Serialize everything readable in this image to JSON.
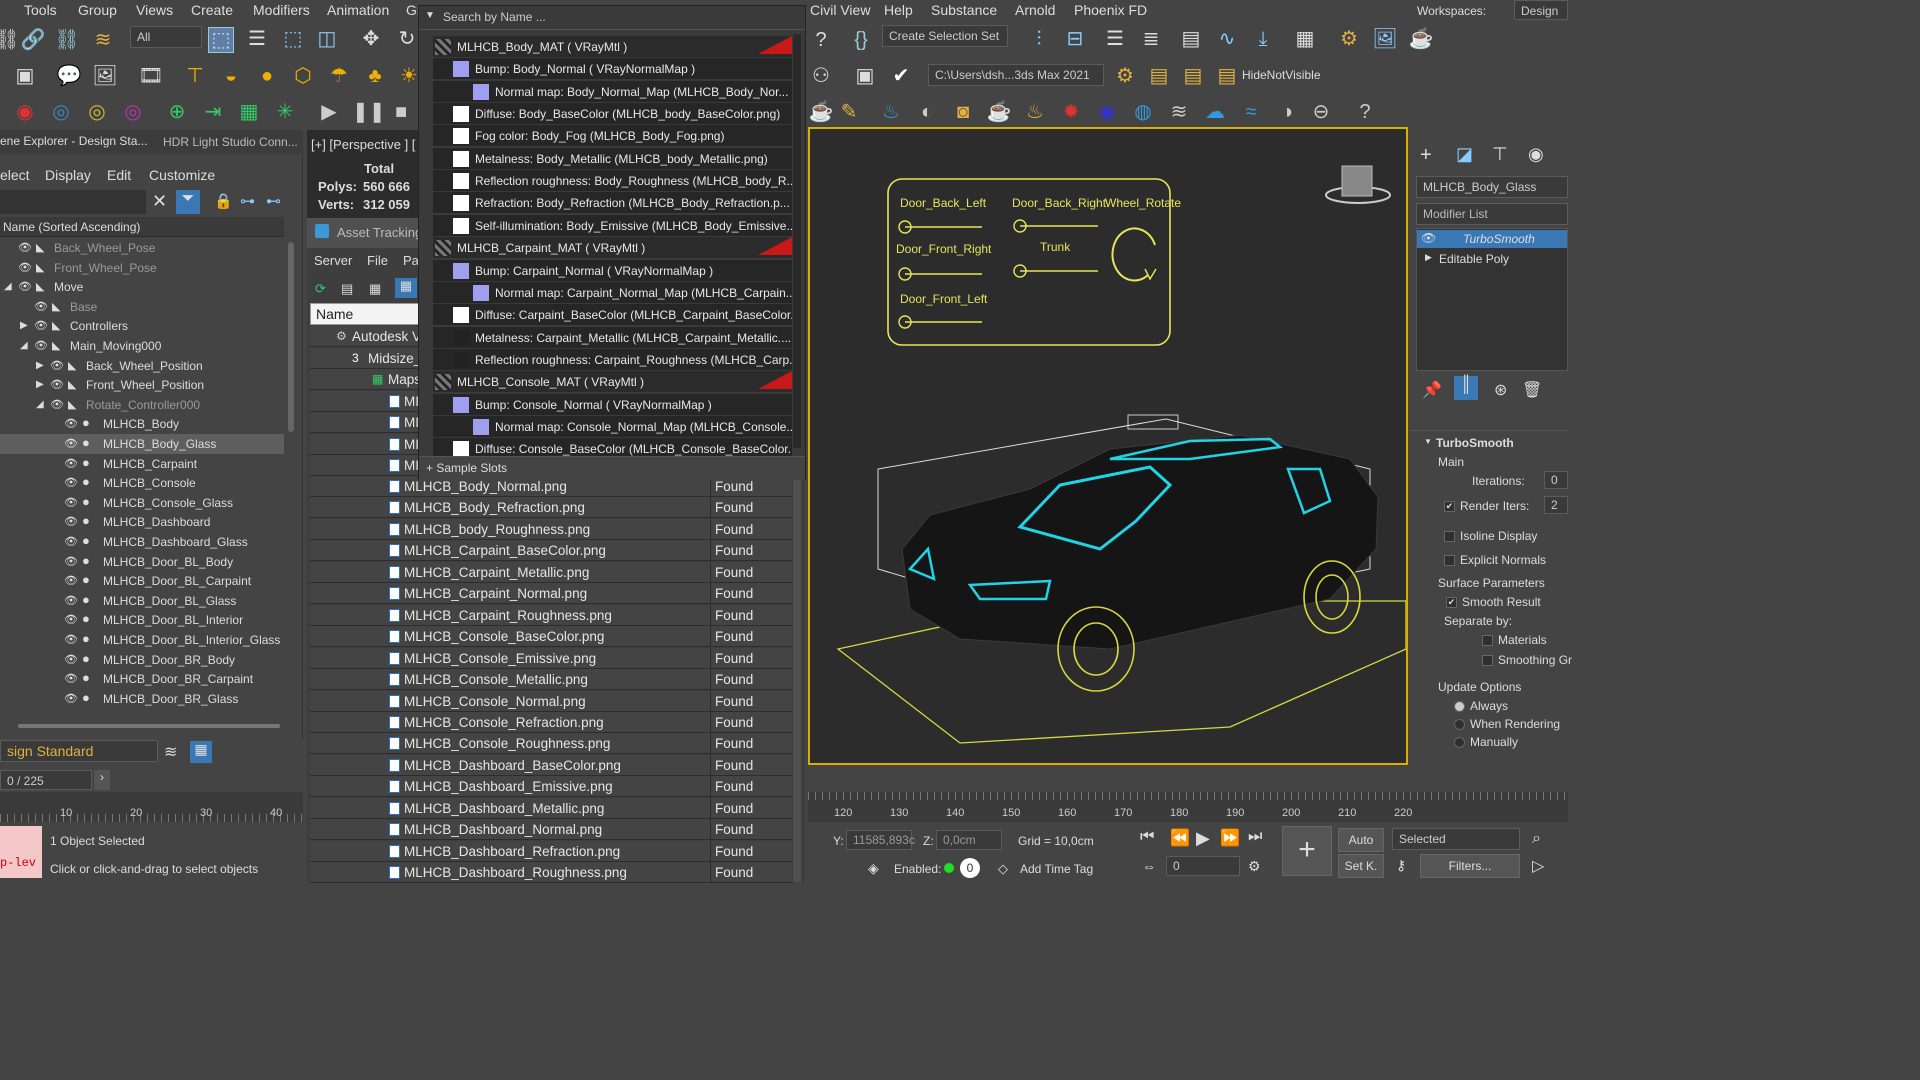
{
  "menu": {
    "tools": "Tools",
    "group": "Group",
    "views": "Views",
    "create": "Create",
    "modifiers": "Modifiers",
    "animation": "Animation",
    "gr": "Gr",
    "civil_view": "Civil View",
    "help": "Help",
    "substance": "Substance",
    "arnold": "Arnold",
    "phoenix": "Phoenix FD",
    "workspaces_label": "Workspaces:",
    "workspaces_value": "Design Standa"
  },
  "toolbar": {
    "filter_value": "All",
    "selection_set": "Create Selection Set",
    "path_value": "C:\\Users\\dsh...3ds Max 2021",
    "hide_not_visible": "HideNotVisible"
  },
  "scene_explorer": {
    "tab1": "ene Explorer - Design Sta...",
    "tab2": "HDR Light Studio Conn...",
    "menu": [
      "elect",
      "Display",
      "Edit",
      "Customize"
    ],
    "header": "Name (Sorted Ascending)",
    "rows": [
      "Back_Wheel_Pose",
      "Front_Wheel_Pose",
      "Move",
      "Base",
      "Controllers",
      "Main_Moving000",
      "Back_Wheel_Position",
      "Front_Wheel_Position",
      "Rotate_Controller000",
      "MLHCB_Body",
      "MLHCB_Body_Glass",
      "MLHCB_Carpaint",
      "MLHCB_Console",
      "MLHCB_Console_Glass",
      "MLHCB_Dashboard",
      "MLHCB_Dashboard_Glass",
      "MLHCB_Door_BL_Body",
      "MLHCB_Door_BL_Carpaint",
      "MLHCB_Door_BL_Glass",
      "MLHCB_Door_BL_Interior",
      "MLHCB_Door_BL_Interior_Glass",
      "MLHCB_Door_BR_Body",
      "MLHCB_Door_BR_Carpaint",
      "MLHCB_Door_BR_Glass"
    ],
    "workspace": "sign Standard",
    "frame_counter": "0 / 225"
  },
  "viewport_label": {
    "label": "[+] [Perspective ] [",
    "total": "Total",
    "polys_label": "Polys:",
    "polys_value": "560 666",
    "verts_label": "Verts:",
    "verts_value": "312 059"
  },
  "asset_tracking": {
    "title": "Asset Tracking",
    "menu": [
      "Server",
      "File",
      "Pa"
    ],
    "col_name": "Name",
    "tree": [
      "Autodesk Va",
      "Midsize_",
      "Maps",
      "MI",
      "MI",
      "MI",
      "MI"
    ],
    "files": [
      {
        "name": "MLHCB_Body_Normal.png",
        "status": "Found"
      },
      {
        "name": "MLHCB_Body_Refraction.png",
        "status": "Found"
      },
      {
        "name": "MLHCB_body_Roughness.png",
        "status": "Found"
      },
      {
        "name": "MLHCB_Carpaint_BaseColor.png",
        "status": "Found"
      },
      {
        "name": "MLHCB_Carpaint_Metallic.png",
        "status": "Found"
      },
      {
        "name": "MLHCB_Carpaint_Normal.png",
        "status": "Found"
      },
      {
        "name": "MLHCB_Carpaint_Roughness.png",
        "status": "Found"
      },
      {
        "name": "MLHCB_Console_BaseColor.png",
        "status": "Found"
      },
      {
        "name": "MLHCB_Console_Emissive.png",
        "status": "Found"
      },
      {
        "name": "MLHCB_Console_Metallic.png",
        "status": "Found"
      },
      {
        "name": "MLHCB_Console_Normal.png",
        "status": "Found"
      },
      {
        "name": "MLHCB_Console_Refraction.png",
        "status": "Found"
      },
      {
        "name": "MLHCB_Console_Roughness.png",
        "status": "Found"
      },
      {
        "name": "MLHCB_Dashboard_BaseColor.png",
        "status": "Found"
      },
      {
        "name": "MLHCB_Dashboard_Emissive.png",
        "status": "Found"
      },
      {
        "name": "MLHCB_Dashboard_Metallic.png",
        "status": "Found"
      },
      {
        "name": "MLHCB_Dashboard_Normal.png",
        "status": "Found"
      },
      {
        "name": "MLHCB_Dashboard_Refraction.png",
        "status": "Found"
      },
      {
        "name": "MLHCB_Dashboard_Roughness.png",
        "status": "Found"
      }
    ]
  },
  "material_browser": {
    "search_placeholder": "Search by Name ...",
    "rows": [
      "MLHCB_Body_MAT  ( VRayMtl )",
      "Bump: Body_Normal  ( VRayNormalMap )",
      "Normal map: Body_Normal_Map  (MLHCB_Body_Nor...",
      "Diffuse: Body_BaseColor (MLHCB_body_BaseColor.png)",
      "Fog color: Body_Fog (MLHCB_Body_Fog.png)",
      "Metalness: Body_Metallic (MLHCB_body_Metallic.png)",
      "Reflection roughness:  Body_Roughness  (MLHCB_body_R...",
      "Refraction:  Body_Refraction  (MLHCB_Body_Refraction.p...",
      "Self-illumination:  Body_Emissive  (MLHCB_Body_Emissive...",
      "MLHCB_Carpaint_MAT  ( VRayMtl )",
      "Bump: Carpaint_Normal  ( VRayNormalMap )",
      "Normal map: Carpaint_Normal_Map  (MLHCB_Carpain...",
      "Diffuse:  Carpaint_BaseColor  (MLHCB_Carpaint_BaseColor...",
      "Metalness:  Carpaint_Metallic  (MLHCB_Carpaint_Metallic....",
      "Reflection roughness:  Carpaint_Roughness  (MLHCB_Carp...",
      "MLHCB_Console_MAT  ( VRayMtl )",
      "Bump: Console_Normal  ( VRayNormalMap )",
      "Normal map: Console_Normal_Map  (MLHCB_Console....",
      "Diffuse:  Console_BaseColor  (MLHCB_Console_BaseColor..."
    ],
    "sample_slots": "+ Sample Slots"
  },
  "viewport_ui": {
    "labels": [
      "Door_Back_Left",
      "Door_Back_Right",
      "Wheel_Rotate",
      "Door_Front_Right",
      "Trunk",
      "Door_Front_Left"
    ]
  },
  "command_panel": {
    "object_name": "MLHCB_Body_Glass",
    "modifier_list": "Modifier List",
    "stack": [
      "TurboSmooth",
      "Editable Poly"
    ],
    "section": "TurboSmooth",
    "main": "Main",
    "iterations_label": "Iterations:",
    "iterations_value": "0",
    "render_iters_label": "Render Iters:",
    "render_iters_value": "2",
    "isoline": "Isoline Display",
    "explicit_normals": "Explicit Normals",
    "surface_params": "Surface Parameters",
    "smooth_result": "Smooth Result",
    "separate_by": "Separate by:",
    "materials": "Materials",
    "smoothing_groups": "Smoothing Gr",
    "update_options": "Update Options",
    "always": "Always",
    "when_rendering": "When Rendering",
    "manually": "Manually"
  },
  "timeline": {
    "left_ticks": [
      "10",
      "20",
      "30",
      "40"
    ],
    "right_ticks": [
      "120",
      "130",
      "140",
      "150",
      "160",
      "170",
      "180",
      "190",
      "200",
      "210",
      "220"
    ]
  },
  "status": {
    "maxscript": "p-lev",
    "objects_selected": "1 Object Selected",
    "prompt": "Click or click-and-drag to select objects",
    "y_label": "Y:",
    "y_value": "11585,893c",
    "z_label": "Z:",
    "z_value": "0,0cm",
    "grid": "Grid = 10,0cm",
    "enabled": "Enabled:",
    "add_time_tag": "Add Time Tag",
    "auto": "Auto",
    "selected": "Selected",
    "set_k": "Set K.",
    "filters": "Filters...",
    "frame_value": "0"
  }
}
